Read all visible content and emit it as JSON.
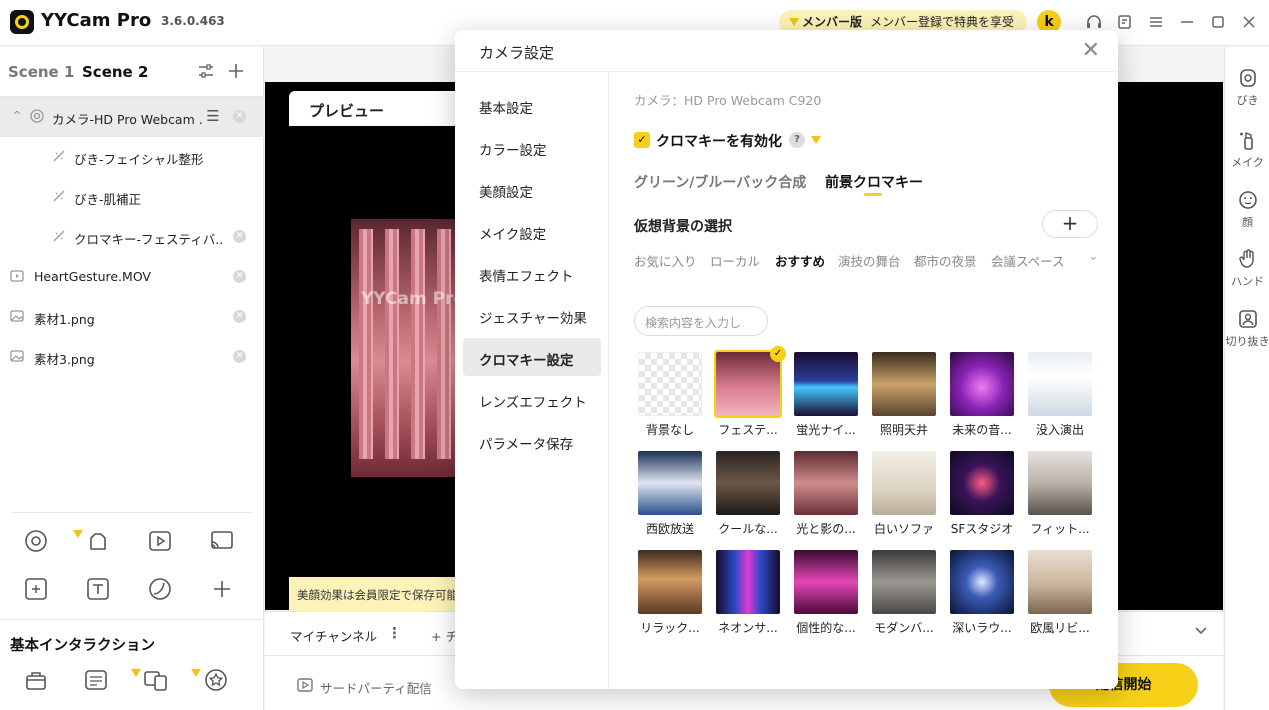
{
  "titlebar": {
    "app_name": "YYCam Pro",
    "version": "3.6.0.463",
    "member_label": "メンバー版",
    "member_promo": "メンバー登録で特典を享受",
    "avatar_letter": "k"
  },
  "left_panel": {
    "scene_tabs": [
      "Scene 1",
      "Scene 2"
    ],
    "sources": [
      {
        "label": "カメラ-HD Pro Webcam ..."
      },
      {
        "label": "びき-フェイシャル整形"
      },
      {
        "label": "びき-肌補正"
      },
      {
        "label": "クロマキー-フェスティバ..."
      },
      {
        "label": "HeartGesture.MOV"
      },
      {
        "label": "素材1.png"
      },
      {
        "label": "素材3.png"
      }
    ],
    "section_title": "基本インタラクション"
  },
  "preview": {
    "title": "プレビュー",
    "watermark": "YYCam Pro",
    "notice": "美顔効果は会員限定で保存可能"
  },
  "channel_bar": {
    "channel_label": "マイチャンネル",
    "add_label": "+ チャンネル"
  },
  "bottom_bar": {
    "third_party_label": "サードパーティ配信",
    "start_label": "配信開始"
  },
  "right_rail": {
    "items": [
      {
        "label": "びき",
        "icon": "beauty-icon"
      },
      {
        "label": "メイク",
        "icon": "makeup-icon"
      },
      {
        "label": "顔",
        "icon": "face-icon"
      },
      {
        "label": "ハンド",
        "icon": "hand-icon"
      },
      {
        "label": "切り抜き",
        "icon": "cutout-icon"
      }
    ]
  },
  "modal": {
    "title": "カメラ設定",
    "nav": [
      {
        "label": "基本設定"
      },
      {
        "label": "カラー設定"
      },
      {
        "label": "美顔設定"
      },
      {
        "label": "メイク設定"
      },
      {
        "label": "表情エフェクト"
      },
      {
        "label": "ジェスチャー効果"
      },
      {
        "label": "クロマキー設定"
      },
      {
        "label": "レンズエフェクト"
      },
      {
        "label": "パラメータ保存"
      }
    ],
    "active_nav": "クロマキー設定",
    "camera_name": "カメラ：HD Pro Webcam C920",
    "enable_label": "クロマキーを有効化",
    "enabled": true,
    "mode_tabs": [
      "グリーン/ブルーバック合成",
      "前景クロマキー"
    ],
    "active_mode": "前景クロマキー",
    "vb_title": "仮想背景の選択",
    "categories": [
      "お気に入り",
      "ローカル",
      "おすすめ",
      "演技の舞台",
      "都市の夜景",
      "会議スペース"
    ],
    "active_category": "おすすめ",
    "search_placeholder": "検索内容を入力し",
    "backgrounds": [
      {
        "label": "背景なし",
        "style": "none"
      },
      {
        "label": "フェステ...",
        "style": "pink-stage",
        "selected": true
      },
      {
        "label": "蛍光ナイ...",
        "style": "neon-blue"
      },
      {
        "label": "照明天井",
        "style": "warm-lounge"
      },
      {
        "label": "未来の音...",
        "style": "purple-stage"
      },
      {
        "label": "没入演出",
        "style": "white-room"
      },
      {
        "label": "西欧放送",
        "style": "blue-studio"
      },
      {
        "label": "クールな...",
        "style": "dark-loft"
      },
      {
        "label": "光と影の...",
        "style": "rose-room"
      },
      {
        "label": "白いソファ",
        "style": "cream-room"
      },
      {
        "label": "SFスタジオ",
        "style": "sf-studio"
      },
      {
        "label": "フィット...",
        "style": "gym"
      },
      {
        "label": "リラック...",
        "style": "sunset-room"
      },
      {
        "label": "ネオンサ...",
        "style": "neon-corridor"
      },
      {
        "label": "個性的な...",
        "style": "magenta-bar"
      },
      {
        "label": "モダンバ...",
        "style": "gray-room"
      },
      {
        "label": "深いラウ...",
        "style": "blue-tunnel"
      },
      {
        "label": "欧風リビ...",
        "style": "living-room"
      }
    ]
  }
}
